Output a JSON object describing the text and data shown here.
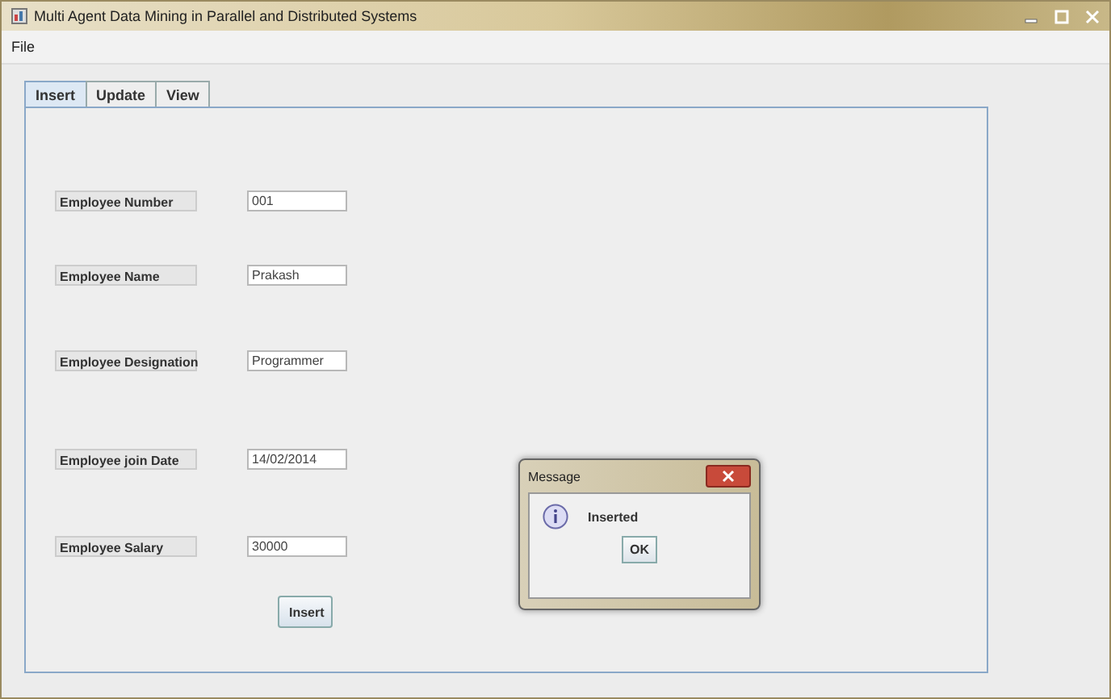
{
  "window": {
    "title": "Multi Agent Data Mining in Parallel and Distributed Systems"
  },
  "menu": [
    "File"
  ],
  "tabs": [
    {
      "label": "Insert",
      "selected": true
    },
    {
      "label": "Update",
      "selected": false
    },
    {
      "label": "View",
      "selected": false
    }
  ],
  "form": [
    {
      "label": "Employee Number",
      "value": "001"
    },
    {
      "label": "Employee Name",
      "value": "Prakash"
    },
    {
      "label": "Employee Designation",
      "value": "Programmer"
    },
    {
      "label": "Employee join Date",
      "value": "14/02/2014"
    },
    {
      "label": "Employee Salary",
      "value": "30000"
    }
  ],
  "submit": "Insert",
  "dialog": {
    "title": "Message",
    "message": "Inserted",
    "button": "OK"
  }
}
